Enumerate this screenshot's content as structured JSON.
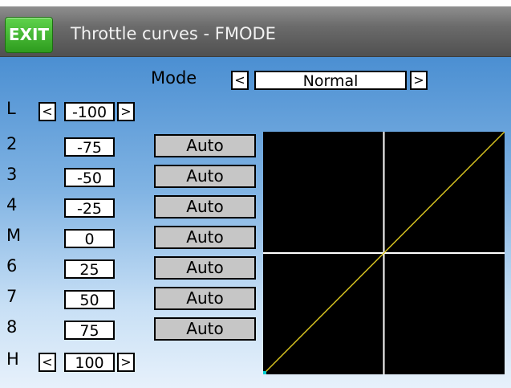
{
  "header": {
    "exit_label": "EXIT",
    "title": "Throttle curves - FMODE"
  },
  "mode": {
    "label": "Mode",
    "value": "Normal",
    "prev": "<",
    "next": ">"
  },
  "points": [
    {
      "label": "L",
      "value": "-100",
      "type": "stepper"
    },
    {
      "label": "2",
      "value": "-75",
      "type": "auto",
      "button": "Auto"
    },
    {
      "label": "3",
      "value": "-50",
      "type": "auto",
      "button": "Auto"
    },
    {
      "label": "4",
      "value": "-25",
      "type": "auto",
      "button": "Auto"
    },
    {
      "label": "M",
      "value": "0",
      "type": "auto",
      "button": "Auto"
    },
    {
      "label": "6",
      "value": "25",
      "type": "auto",
      "button": "Auto"
    },
    {
      "label": "7",
      "value": "50",
      "type": "auto",
      "button": "Auto"
    },
    {
      "label": "8",
      "value": "75",
      "type": "auto",
      "button": "Auto"
    },
    {
      "label": "H",
      "value": "100",
      "type": "stepper"
    }
  ],
  "stepper": {
    "prev": "<",
    "next": ">"
  },
  "curve": {
    "type": "line",
    "x": [
      -100,
      100
    ],
    "y": [
      -100,
      100
    ],
    "line_color": "#d4c020",
    "grid_color": "#ffffff",
    "background": "#000000"
  },
  "colors": {
    "exit": "#3fb52d",
    "header": "#6b6b6b",
    "background_top": "#4b8fd2",
    "background_bottom": "#e7f1fb"
  }
}
